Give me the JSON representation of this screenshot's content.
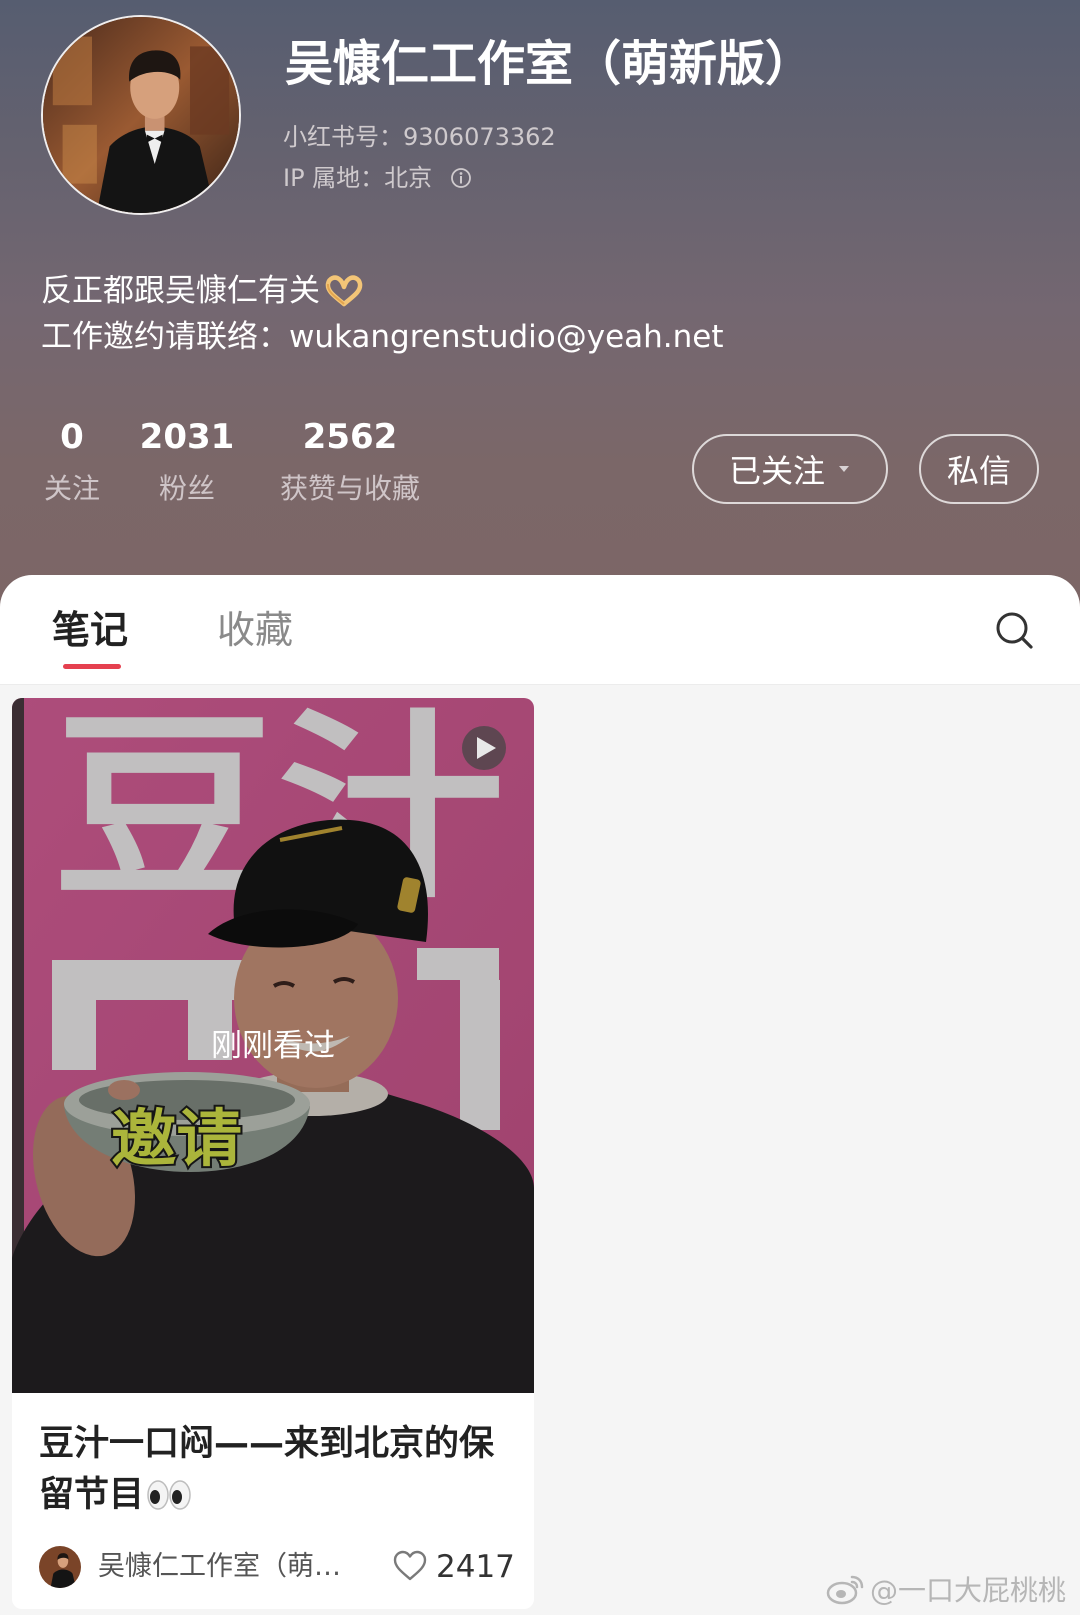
{
  "profile": {
    "name": "吴慷仁工作室（萌新版）",
    "red_id": "小红书号：9306073362",
    "ip_location": "IP 属地：北京",
    "info_icon": "info-icon",
    "bio_line1": "反正都跟吴慷仁有关",
    "bio_line1_emoji": "heart-hands-emoji",
    "bio_line2": "工作邀约请联络：wukangrenstudio@yeah.net",
    "avatar": "profile-avatar-photo"
  },
  "stats": [
    {
      "value": "0",
      "label": "关注"
    },
    {
      "value": "2031",
      "label": "粉丝"
    },
    {
      "value": "2562",
      "label": "获赞与收藏"
    }
  ],
  "actions": {
    "follow_label": "已关注",
    "follow_icon": "caret-down-icon",
    "message_label": "私信"
  },
  "tabs": [
    {
      "label": "笔记",
      "active": true
    },
    {
      "label": "收藏",
      "active": false
    }
  ],
  "search_icon": "search-icon",
  "notes": [
    {
      "cover": {
        "big_text": "豆汁",
        "bowl_text": "邀请",
        "badge": "刚刚看过",
        "type_icon": "play-icon"
      },
      "title": "豆汁一口闷——来到北京的保留节目",
      "title_emoji": "eyes-emoji",
      "author": "吴慷仁工作室（萌…",
      "like_icon": "heart-icon",
      "likes": "2417"
    }
  ],
  "watermark": "@一口大屁桃桃",
  "colors": {
    "accent": "#e5404f",
    "header_top": "#565d70",
    "header_bottom": "#7c6666",
    "page_bg": "#f5f5f5"
  }
}
